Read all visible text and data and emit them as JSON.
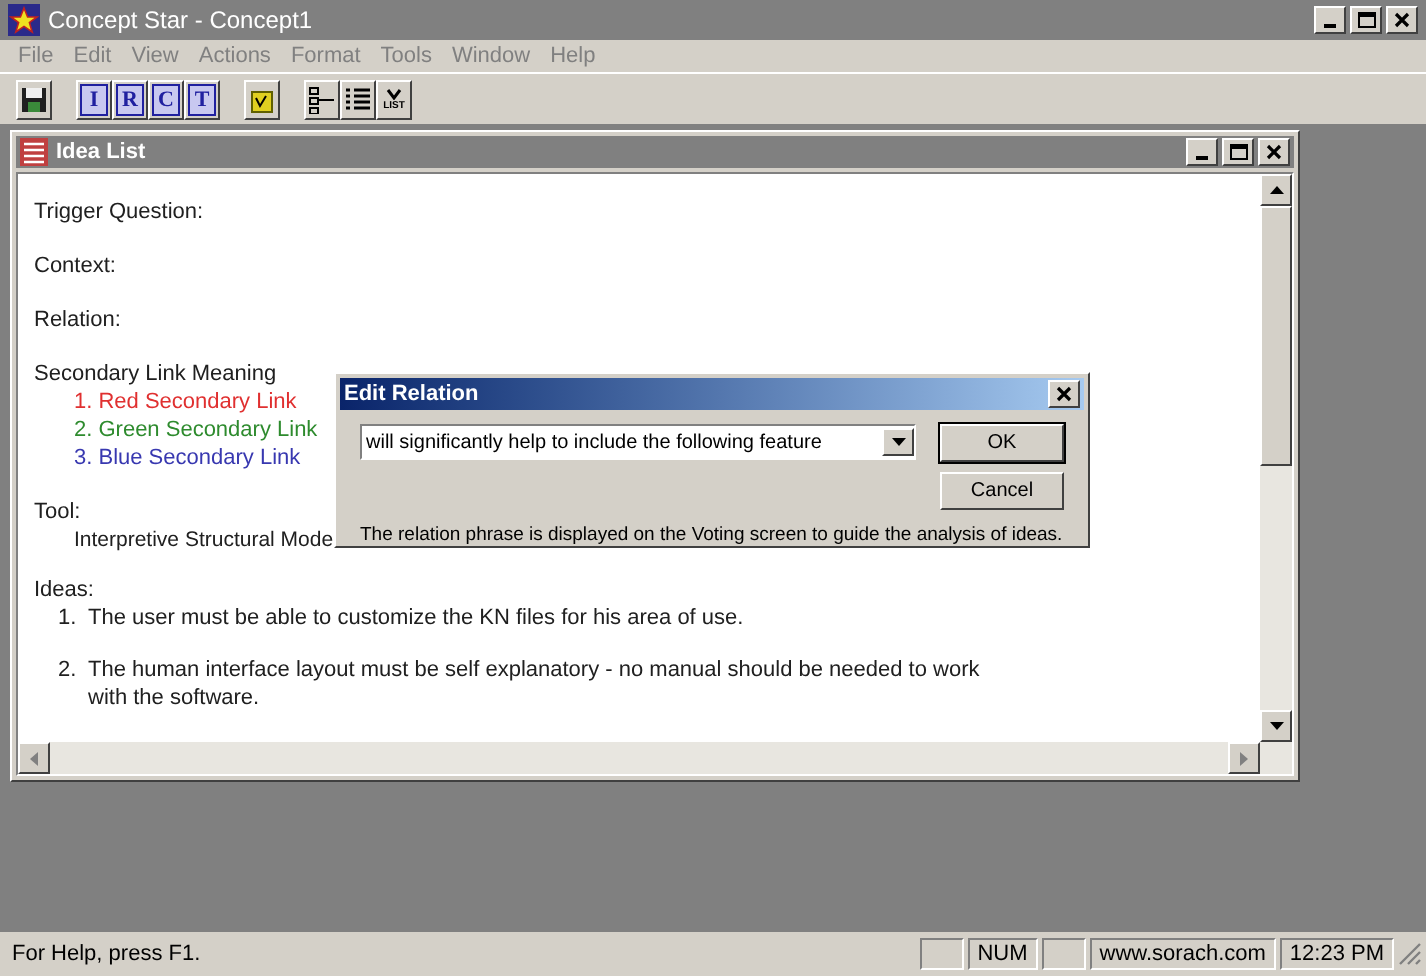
{
  "window": {
    "title": "Concept Star - Concept1"
  },
  "menu": [
    "File",
    "Edit",
    "View",
    "Actions",
    "Format",
    "Tools",
    "Window",
    "Help"
  ],
  "toolbar": {
    "letter_buttons": [
      "I",
      "R",
      "C",
      "T"
    ],
    "list_button": "LIST"
  },
  "child_window": {
    "title": "Idea List",
    "sections": [
      {
        "label": "Trigger Question:"
      },
      {
        "label": "Context:"
      },
      {
        "label": "Relation:"
      },
      {
        "label": "Secondary Link Meaning",
        "links": [
          {
            "text": "1. Red Secondary Link",
            "color": "#e03030"
          },
          {
            "text": "2. Green Secondary Link",
            "color": "#2e8b2e"
          },
          {
            "text": "3. Blue Secondary Link",
            "color": "#3838b0"
          }
        ]
      },
      {
        "label": "Tool:",
        "value": "Interpretive Structural Mode"
      }
    ],
    "ideas_label": "Ideas:",
    "ideas": [
      {
        "number": "1.",
        "text": "The user must be able to customize the KN files for his area of use."
      },
      {
        "number": "2.",
        "text": "The human interface layout must be self explanatory - no manual should be needed to work",
        "continuation": "with the software."
      }
    ]
  },
  "dialog": {
    "title": "Edit Relation",
    "value": "will significantly help to include the following feature",
    "buttons": [
      "OK",
      "Cancel"
    ],
    "note": "The relation phrase is displayed on the Voting screen to guide the analysis of ideas."
  },
  "status_bar": {
    "help": "For Help, press F1.",
    "panes": [
      "NUM",
      "www.sorach.com",
      "12:23  PM"
    ]
  }
}
